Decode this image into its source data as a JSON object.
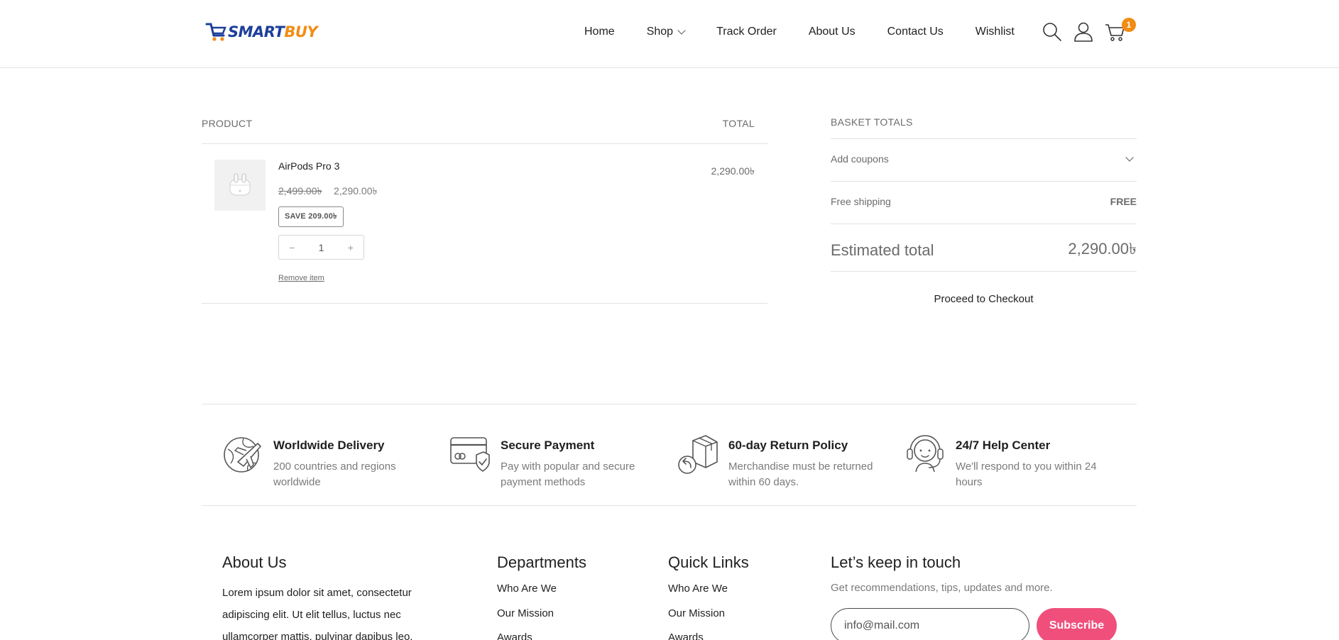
{
  "brand": {
    "name_part1": "SMART",
    "name_part2": "BUY",
    "accent": "#f28c13",
    "primary": "#1d3f9a"
  },
  "nav": {
    "items": [
      "Home",
      "Shop",
      "Track Order",
      "About Us",
      "Contact Us",
      "Wishlist"
    ],
    "cart_count": "1"
  },
  "cart": {
    "headers": {
      "product": "PRODUCT",
      "total": "TOTAL"
    },
    "item": {
      "name": "AirPods Pro 3",
      "old_price": "2,499.00৳",
      "price": "2,290.00৳",
      "save": "SAVE 209.00৳",
      "qty_minus": "−",
      "quantity": "1",
      "qty_plus": "+",
      "remove": "Remove item",
      "line_total": "2,290.00৳"
    }
  },
  "totals": {
    "title": "BASKET TOTALS",
    "coupons": "Add coupons",
    "shipping_label": "Free shipping",
    "shipping_value": "FREE",
    "estimated_label": "Estimated total",
    "estimated_value": "2,290.00৳",
    "checkout": "Proceed to Checkout"
  },
  "features": [
    {
      "icon": "globe-plane-icon",
      "title": "Worldwide Delivery",
      "desc": "200 countries and regions worldwide"
    },
    {
      "icon": "credit-card-shield-icon",
      "title": "Secure Payment",
      "desc": "Pay with popular and secure payment methods"
    },
    {
      "icon": "return-box-icon",
      "title": "60-day Return Policy",
      "desc": "Merchandise must be returned within 60 days."
    },
    {
      "icon": "headset-support-icon",
      "title": "24/7 Help Center",
      "desc": "We'll respond to you within 24 hours"
    }
  ],
  "footer": {
    "about_title": "About Us",
    "about_text": "Lorem ipsum dolor sit amet, consectetur adipiscing elit. Ut elit tellus, luctus nec ullamcorper mattis, pulvinar dapibus leo.",
    "departments_title": "Departments",
    "departments": [
      "Who Are We",
      "Our Mission",
      "Awards"
    ],
    "quick_title": "Quick Links",
    "quick_links": [
      "Who Are We",
      "Our Mission",
      "Awards"
    ],
    "keep_title": "Let’s keep in touch",
    "keep_sub": "Get recommendations, tips, updates and more.",
    "email_placeholder": "info@mail.com",
    "subscribe": "Subscribe",
    "subscribe_color": "#f04f7c"
  }
}
